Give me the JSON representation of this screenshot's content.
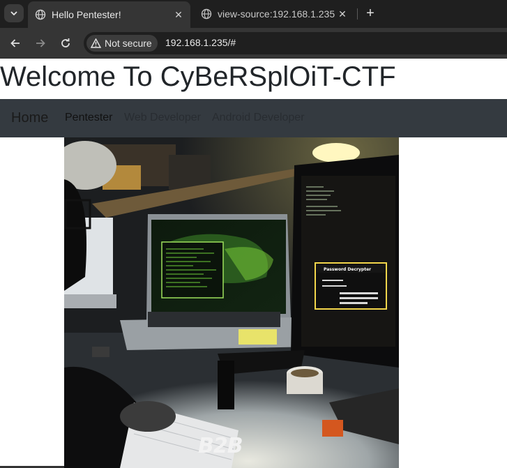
{
  "browser": {
    "tabs": [
      {
        "title": "Hello Pentester!",
        "active": true
      },
      {
        "title": "view-source:192.168.1.235",
        "active": false
      }
    ],
    "security_label": "Not secure",
    "url": "192.168.1.235/#"
  },
  "page": {
    "heading": "Welcome To CyBeRSplOiT-CTF",
    "navbar": {
      "brand": "Home",
      "links": [
        "Pentester",
        "Web Developer",
        "Android Developer"
      ]
    },
    "image": {
      "watermark": "B2B",
      "dialog_title": "Password Decrypter"
    }
  },
  "colors": {
    "navbar_bg": "#343a40",
    "chrome_dark": "#1f1f1f",
    "chrome_toolbar": "#353535"
  }
}
